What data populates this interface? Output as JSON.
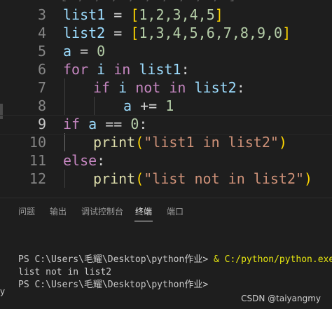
{
  "editor": {
    "top_strip": "[ , , , , , , , , , ]",
    "lines": [
      {
        "num": "3"
      },
      {
        "num": "4"
      },
      {
        "num": "5"
      },
      {
        "num": "6"
      },
      {
        "num": "7"
      },
      {
        "num": "8"
      },
      {
        "num": "9"
      },
      {
        "num": "10"
      },
      {
        "num": "11"
      },
      {
        "num": "12"
      }
    ],
    "code": {
      "l3_var": "list1",
      "l3_eq": " = ",
      "l3_open": "[",
      "l3_vals": "1,2,3,4,5",
      "l3_close": "]",
      "l4_var": "list2",
      "l4_eq": " = ",
      "l4_open": "[",
      "l4_vals": "1,3,4,5,6,7,8,9,0",
      "l4_close": "]",
      "l5_var": "a",
      "l5_eq": " = ",
      "l5_val": "0",
      "l6_for": "for",
      "l6_i": " i ",
      "l6_in": "in",
      "l6_list": " list1",
      "l6_colon": ":",
      "l7_if": "if",
      "l7_i": " i ",
      "l7_notin": "not in",
      "l7_list": " list2",
      "l7_colon": ":",
      "l8_a": "a",
      "l8_op": " += ",
      "l8_val": "1",
      "l9_if": "if",
      "l9_a": " a",
      "l9_op": " == ",
      "l9_val": "0",
      "l9_colon": ":",
      "l10_fn": "print",
      "l10_open": "(",
      "l10_str": "\"list1 in list2\"",
      "l10_close": ")",
      "l11_else": "else",
      "l11_colon": ":",
      "l12_fn": "print",
      "l12_open": "(",
      "l12_str": "\"list not in list2\"",
      "l12_close": ")"
    }
  },
  "panel": {
    "tabs": [
      {
        "label": "问题"
      },
      {
        "label": "输出"
      },
      {
        "label": "调试控制台"
      },
      {
        "label": "终端"
      },
      {
        "label": "端口"
      }
    ],
    "active_tab": "终端",
    "terminal": {
      "line1_prompt": "PS C:\\Users\\毛耀\\Desktop\\python作业> ",
      "line1_cmd": "& C:/python/python.exe",
      "line2": "list not in list2",
      "line3": "PS C:\\Users\\毛耀\\Desktop\\python作业>"
    },
    "edge_mark": "y"
  },
  "watermark": "CSDN @taiyangmy",
  "colors": {
    "background": "#1e1e1e",
    "keyword": "#c586c0",
    "variable": "#9cdcfe",
    "number": "#b5cea8",
    "function": "#dcdcaa",
    "string": "#ce9178",
    "bracket_level1": "#ffd700",
    "bracket_level2": "#da70d6",
    "terminal_command": "#e5e510"
  }
}
